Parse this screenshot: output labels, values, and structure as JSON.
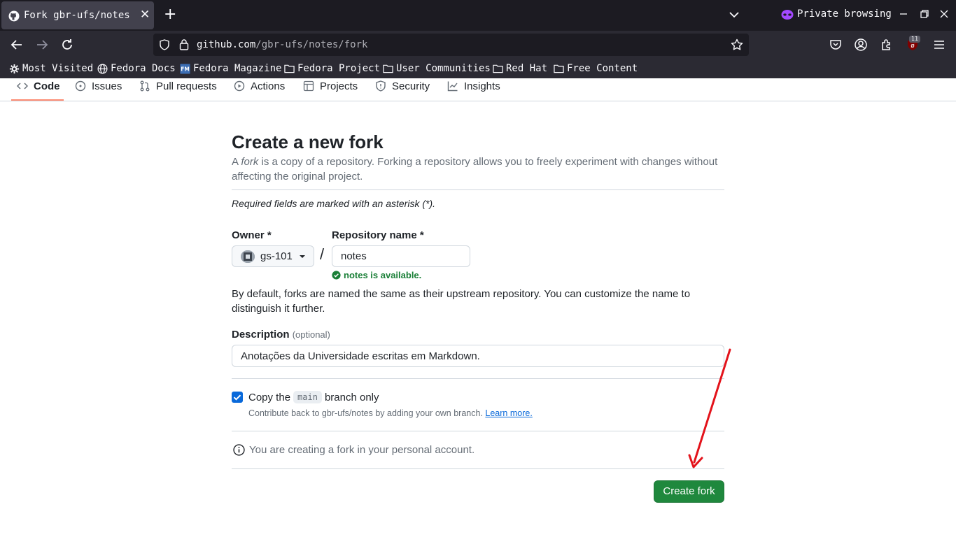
{
  "browser": {
    "tab_title": "Fork gbr-ufs/notes",
    "new_tab_symbol": "+",
    "close_symbol": "✕",
    "private_label": "Private browsing",
    "url_host": "github.com",
    "url_path": "/gbr-ufs/notes/fork",
    "extension_badge": "11",
    "bookmarks": [
      {
        "label": "Most Visited",
        "icon": "gear-icon"
      },
      {
        "label": "Fedora Docs",
        "icon": "globe-icon"
      },
      {
        "label": "Fedora Magazine",
        "icon": "fm-icon"
      },
      {
        "label": "Fedora Project",
        "icon": "folder-icon"
      },
      {
        "label": "User Communities",
        "icon": "folder-icon"
      },
      {
        "label": "Red Hat",
        "icon": "folder-icon"
      },
      {
        "label": "Free Content",
        "icon": "folder-icon"
      }
    ]
  },
  "repo_nav": {
    "items": [
      {
        "label": "Code",
        "icon": "code-icon",
        "active": true
      },
      {
        "label": "Issues",
        "icon": "issue-icon"
      },
      {
        "label": "Pull requests",
        "icon": "pull-request-icon"
      },
      {
        "label": "Actions",
        "icon": "play-icon"
      },
      {
        "label": "Projects",
        "icon": "table-icon"
      },
      {
        "label": "Security",
        "icon": "shield-icon"
      },
      {
        "label": "Insights",
        "icon": "graph-icon"
      }
    ]
  },
  "form": {
    "title": "Create a new fork",
    "subtitle_prefix": "A ",
    "subtitle_em": "fork",
    "subtitle_rest": " is a copy of a repository. Forking a repository allows you to freely experiment with changes without affecting the original project.",
    "required_note": "Required fields are marked with an asterisk (*).",
    "owner_label": "Owner *",
    "owner_value": "gs-101",
    "slash": "/",
    "repo_label": "Repository name *",
    "repo_value": "notes",
    "availability": "notes is available.",
    "default_note": "By default, forks are named the same as their upstream repository. You can customize the name to distinguish it further.",
    "description_label": "Description",
    "description_optional": "(optional)",
    "description_value": "Anotações da Universidade escritas em Markdown.",
    "copy_prefix": "Copy the",
    "copy_branch": "main",
    "copy_suffix": "branch only",
    "copy_checked": true,
    "contrib_text": "Contribute back to gbr-ufs/notes by adding your own branch.",
    "learn_more": "Learn more.",
    "info_text": "You are creating a fork in your personal account.",
    "submit_label": "Create fork"
  },
  "colors": {
    "primary_button": "#1f883d",
    "link": "#0969da",
    "success": "#1a7f37",
    "annotation_arrow": "#e3131b",
    "active_tab_underline": "#fd8c73"
  }
}
